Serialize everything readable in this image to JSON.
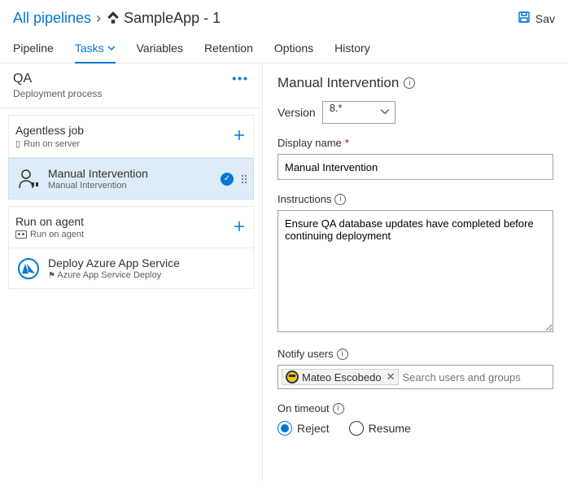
{
  "breadcrumb": {
    "root": "All pipelines",
    "current": "SampleApp - 1"
  },
  "toolbar": {
    "save": "Sav"
  },
  "tabs": [
    {
      "label": "Pipeline",
      "active": false
    },
    {
      "label": "Tasks",
      "active": true,
      "hasChevron": true
    },
    {
      "label": "Variables",
      "active": false
    },
    {
      "label": "Retention",
      "active": false
    },
    {
      "label": "Options",
      "active": false
    },
    {
      "label": "History",
      "active": false
    }
  ],
  "stage": {
    "name": "QA",
    "subtitle": "Deployment process"
  },
  "jobs": [
    {
      "title": "Agentless job",
      "subtitle": "Run on server",
      "iconType": "server"
    },
    {
      "title": "Run on agent",
      "subtitle": "Run on agent",
      "iconType": "agent"
    }
  ],
  "tasks": {
    "agentless": [
      {
        "title": "Manual Intervention",
        "subtitle": "Manual Intervention",
        "selected": true,
        "icon": "person"
      }
    ],
    "agent": [
      {
        "title": "Deploy Azure App Service",
        "subtitle": "Azure App Service Deploy",
        "selected": false,
        "icon": "azure"
      }
    ]
  },
  "details": {
    "title": "Manual Intervention",
    "versionLabel": "Version",
    "version": "8.*",
    "displayNameLabel": "Display name",
    "displayName": "Manual Intervention",
    "instructionsLabel": "Instructions",
    "instructions": "Ensure QA database updates have completed before continuing deployment",
    "notifyLabel": "Notify users",
    "notifyUser": "Mateo Escobedo",
    "notifyPlaceholder": "Search users and groups",
    "timeoutLabel": "On timeout",
    "timeoutOptions": {
      "reject": "Reject",
      "resume": "Resume"
    },
    "timeoutSelected": "reject"
  }
}
